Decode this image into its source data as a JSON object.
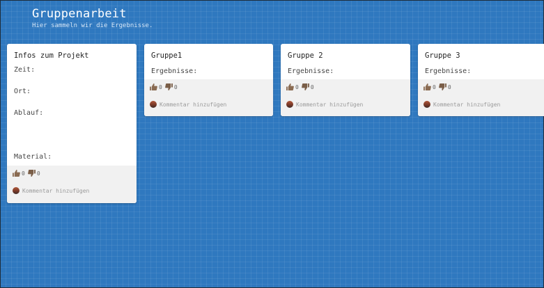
{
  "header": {
    "title": "Gruppenarbeit",
    "subtitle": "Hier sammeln wir die Ergebnisse."
  },
  "cards": [
    {
      "title": "Infos zum Projekt",
      "lines": [
        "Zeit:",
        "Ort:",
        "Ablauf:",
        "Material:"
      ],
      "likes": "0",
      "dislikes": "0",
      "comment_placeholder": "Kommentar hinzufügen"
    },
    {
      "title": "Gruppe1",
      "lines": [
        "Ergebnisse:"
      ],
      "likes": "0",
      "dislikes": "0",
      "comment_placeholder": "Kommentar hinzufügen"
    },
    {
      "title": "Gruppe 2",
      "lines": [
        "Ergebnisse:"
      ],
      "likes": "0",
      "dislikes": "0",
      "comment_placeholder": "Kommentar hinzufügen"
    },
    {
      "title": "Gruppe 3",
      "lines": [
        "Ergebnisse:"
      ],
      "likes": "0",
      "dislikes": "0",
      "comment_placeholder": "Kommentar hinzufügen"
    }
  ],
  "colors": {
    "background": "#2f78bf",
    "card": "#ffffff",
    "footer": "#f1f1f1"
  },
  "icons": [
    "thumbs-up-icon",
    "thumbs-down-icon",
    "avatar"
  ]
}
